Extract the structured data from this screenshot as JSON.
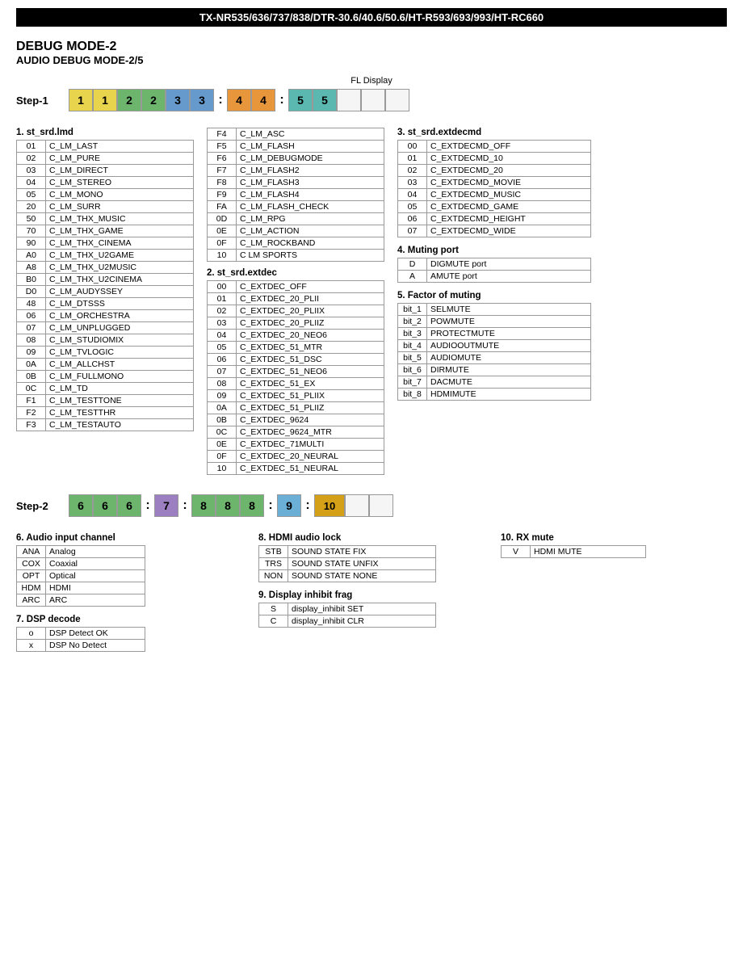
{
  "header": {
    "title": "TX-NR535/636/737/838/DTR-30.6/40.6/50.6/HT-R593/693/993/HT-RC660"
  },
  "page_title": {
    "line1": "DEBUG MODE-2",
    "line2": "AUDIO DEBUG MODE-2/5"
  },
  "fl_display": "FL Display",
  "step1": {
    "label": "Step-1",
    "cells": [
      {
        "value": "1",
        "color": "yellow"
      },
      {
        "value": "1",
        "color": "yellow"
      },
      {
        "value": "2",
        "color": "green"
      },
      {
        "value": "2",
        "color": "green"
      },
      {
        "value": "3",
        "color": "blue"
      },
      {
        "value": "3",
        "color": "blue"
      },
      {
        "value": ":",
        "color": "colon"
      },
      {
        "value": "4",
        "color": "orange"
      },
      {
        "value": "4",
        "color": "orange"
      },
      {
        "value": ":",
        "color": "colon"
      },
      {
        "value": "5",
        "color": "teal"
      },
      {
        "value": "5",
        "color": "teal"
      },
      {
        "value": "",
        "color": "empty"
      },
      {
        "value": "",
        "color": "empty"
      },
      {
        "value": "",
        "color": "empty"
      }
    ]
  },
  "step2": {
    "label": "Step-2",
    "cells": [
      {
        "value": "6",
        "color": "green"
      },
      {
        "value": "6",
        "color": "green"
      },
      {
        "value": "6",
        "color": "green"
      },
      {
        "value": ":",
        "color": "colon"
      },
      {
        "value": "7",
        "color": "purple"
      },
      {
        "value": ":",
        "color": "colon"
      },
      {
        "value": "8",
        "color": "green"
      },
      {
        "value": "8",
        "color": "green"
      },
      {
        "value": "8",
        "color": "green"
      },
      {
        "value": ":",
        "color": "colon"
      },
      {
        "value": "9",
        "color": "light-blue"
      },
      {
        "value": ":",
        "color": "colon"
      },
      {
        "value": "10",
        "color": "gold"
      },
      {
        "value": "",
        "color": "empty"
      },
      {
        "value": "",
        "color": "empty"
      }
    ]
  },
  "section1": {
    "title": "1. st_srd.lmd",
    "rows": [
      {
        "code": "01",
        "value": "C_LM_LAST"
      },
      {
        "code": "02",
        "value": "C_LM_PURE"
      },
      {
        "code": "03",
        "value": "C_LM_DIRECT"
      },
      {
        "code": "04",
        "value": "C_LM_STEREO"
      },
      {
        "code": "05",
        "value": "C_LM_MONO"
      },
      {
        "code": "20",
        "value": "C_LM_SURR"
      },
      {
        "code": "50",
        "value": "C_LM_THX_MUSIC"
      },
      {
        "code": "70",
        "value": "C_LM_THX_GAME"
      },
      {
        "code": "90",
        "value": "C_LM_THX_CINEMA"
      },
      {
        "code": "A0",
        "value": "C_LM_THX_U2GAME"
      },
      {
        "code": "A8",
        "value": "C_LM_THX_U2MUSIC"
      },
      {
        "code": "B0",
        "value": "C_LM_THX_U2CINEMA"
      },
      {
        "code": "D0",
        "value": "C_LM_AUDYSSEY"
      },
      {
        "code": "48",
        "value": "C_LM_DTSSS"
      },
      {
        "code": "06",
        "value": "C_LM_ORCHESTRA"
      },
      {
        "code": "07",
        "value": "C_LM_UNPLUGGED"
      },
      {
        "code": "08",
        "value": "C_LM_STUDIOMIX"
      },
      {
        "code": "09",
        "value": "C_LM_TVLOGIC"
      },
      {
        "code": "0A",
        "value": "C_LM_ALLCHST"
      },
      {
        "code": "0B",
        "value": "C_LM_FULLMONO"
      },
      {
        "code": "0C",
        "value": "C_LM_TD"
      },
      {
        "code": "F1",
        "value": "C_LM_TESTTONE"
      },
      {
        "code": "F2",
        "value": "C_LM_TESTTHR"
      },
      {
        "code": "F3",
        "value": "C_LM_TESTAUTO"
      }
    ]
  },
  "section1b": {
    "rows": [
      {
        "code": "F4",
        "value": "C_LM_ASC"
      },
      {
        "code": "F5",
        "value": "C_LM_FLASH"
      },
      {
        "code": "F6",
        "value": "C_LM_DEBUGMODE"
      },
      {
        "code": "F7",
        "value": "C_LM_FLASH2"
      },
      {
        "code": "F8",
        "value": "C_LM_FLASH3"
      },
      {
        "code": "F9",
        "value": "C_LM_FLASH4"
      },
      {
        "code": "FA",
        "value": "C_LM_FLASH_CHECK"
      },
      {
        "code": "0D",
        "value": "C_LM_RPG"
      },
      {
        "code": "0E",
        "value": "C_LM_ACTION"
      },
      {
        "code": "0F",
        "value": "C_LM_ROCKBAND"
      },
      {
        "code": "10",
        "value": "C LM  SPORTS"
      }
    ]
  },
  "section2": {
    "title": "2. st_srd.extdec",
    "rows": [
      {
        "code": "00",
        "value": "C_EXTDEC_OFF"
      },
      {
        "code": "01",
        "value": "C_EXTDEC_20_PLII"
      },
      {
        "code": "02",
        "value": "C_EXTDEC_20_PLIIX"
      },
      {
        "code": "03",
        "value": "C_EXTDEC_20_PLIIZ"
      },
      {
        "code": "04",
        "value": "C_EXTDEC_20_NEO6"
      },
      {
        "code": "05",
        "value": "C_EXTDEC_51_MTR"
      },
      {
        "code": "06",
        "value": "C_EXTDEC_51_DSC"
      },
      {
        "code": "07",
        "value": "C_EXTDEC_51_NEO6"
      },
      {
        "code": "08",
        "value": "C_EXTDEC_51_EX"
      },
      {
        "code": "09",
        "value": "C_EXTDEC_51_PLIIX"
      },
      {
        "code": "0A",
        "value": "C_EXTDEC_51_PLIIZ"
      },
      {
        "code": "0B",
        "value": "C_EXTDEC_9624"
      },
      {
        "code": "0C",
        "value": "C_EXTDEC_9624_MTR"
      },
      {
        "code": "0E",
        "value": "C_EXTDEC_71MULTI"
      },
      {
        "code": "0F",
        "value": "C_EXTDEC_20_NEURAL"
      },
      {
        "code": "10",
        "value": "C_EXTDEC_51_NEURAL"
      }
    ]
  },
  "section3": {
    "title": "3. st_srd.extdecmd",
    "rows": [
      {
        "code": "00",
        "value": "C_EXTDECMD_OFF"
      },
      {
        "code": "01",
        "value": "C_EXTDECMD_10"
      },
      {
        "code": "02",
        "value": "C_EXTDECMD_20"
      },
      {
        "code": "03",
        "value": "C_EXTDECMD_MOVIE"
      },
      {
        "code": "04",
        "value": "C_EXTDECMD_MUSIC"
      },
      {
        "code": "05",
        "value": "C_EXTDECMD_GAME"
      },
      {
        "code": "06",
        "value": "C_EXTDECMD_HEIGHT"
      },
      {
        "code": "07",
        "value": "C_EXTDECMD_WIDE"
      }
    ]
  },
  "section4": {
    "title": "4. Muting port",
    "rows": [
      {
        "code": "D",
        "value": "DIGMUTE port"
      },
      {
        "code": "A",
        "value": "AMUTE port"
      }
    ]
  },
  "section5": {
    "title": "5. Factor of muting",
    "rows": [
      {
        "code": "bit_1",
        "value": "SELMUTE"
      },
      {
        "code": "bit_2",
        "value": "POWMUTE"
      },
      {
        "code": "bit_3",
        "value": "PROTECTMUTE"
      },
      {
        "code": "bit_4",
        "value": "AUDIOOUTMUTE"
      },
      {
        "code": "bit_5",
        "value": "AUDIOMUTE"
      },
      {
        "code": "bit_6",
        "value": "DIRMUTE"
      },
      {
        "code": "bit_7",
        "value": "DACMUTE"
      },
      {
        "code": "bit_8",
        "value": "HDMIMUTE"
      }
    ]
  },
  "section6": {
    "title": "6. Audio input channel",
    "rows": [
      {
        "code": "ANA",
        "value": "Analog"
      },
      {
        "code": "COX",
        "value": "Coaxial"
      },
      {
        "code": "OPT",
        "value": "Optical"
      },
      {
        "code": "HDM",
        "value": "HDMI"
      },
      {
        "code": "ARC",
        "value": "ARC"
      }
    ]
  },
  "section7": {
    "title": "7. DSP decode",
    "rows": [
      {
        "code": "o",
        "value": "DSP Detect OK"
      },
      {
        "code": "x",
        "value": "DSP No Detect"
      }
    ]
  },
  "section8": {
    "title": "8. HDMI audio lock",
    "rows": [
      {
        "code": "STB",
        "value": "SOUND STATE FIX"
      },
      {
        "code": "TRS",
        "value": "SOUND STATE UNFIX"
      },
      {
        "code": "NON",
        "value": "SOUND STATE NONE"
      }
    ]
  },
  "section9": {
    "title": "9. Display inhibit frag",
    "rows": [
      {
        "code": "S",
        "value": "display_inhibit SET"
      },
      {
        "code": "C",
        "value": "display_inhibit CLR"
      }
    ]
  },
  "section10": {
    "title": "10. RX mute",
    "rows": [
      {
        "code": "V",
        "value": "HDMI MUTE"
      }
    ]
  }
}
